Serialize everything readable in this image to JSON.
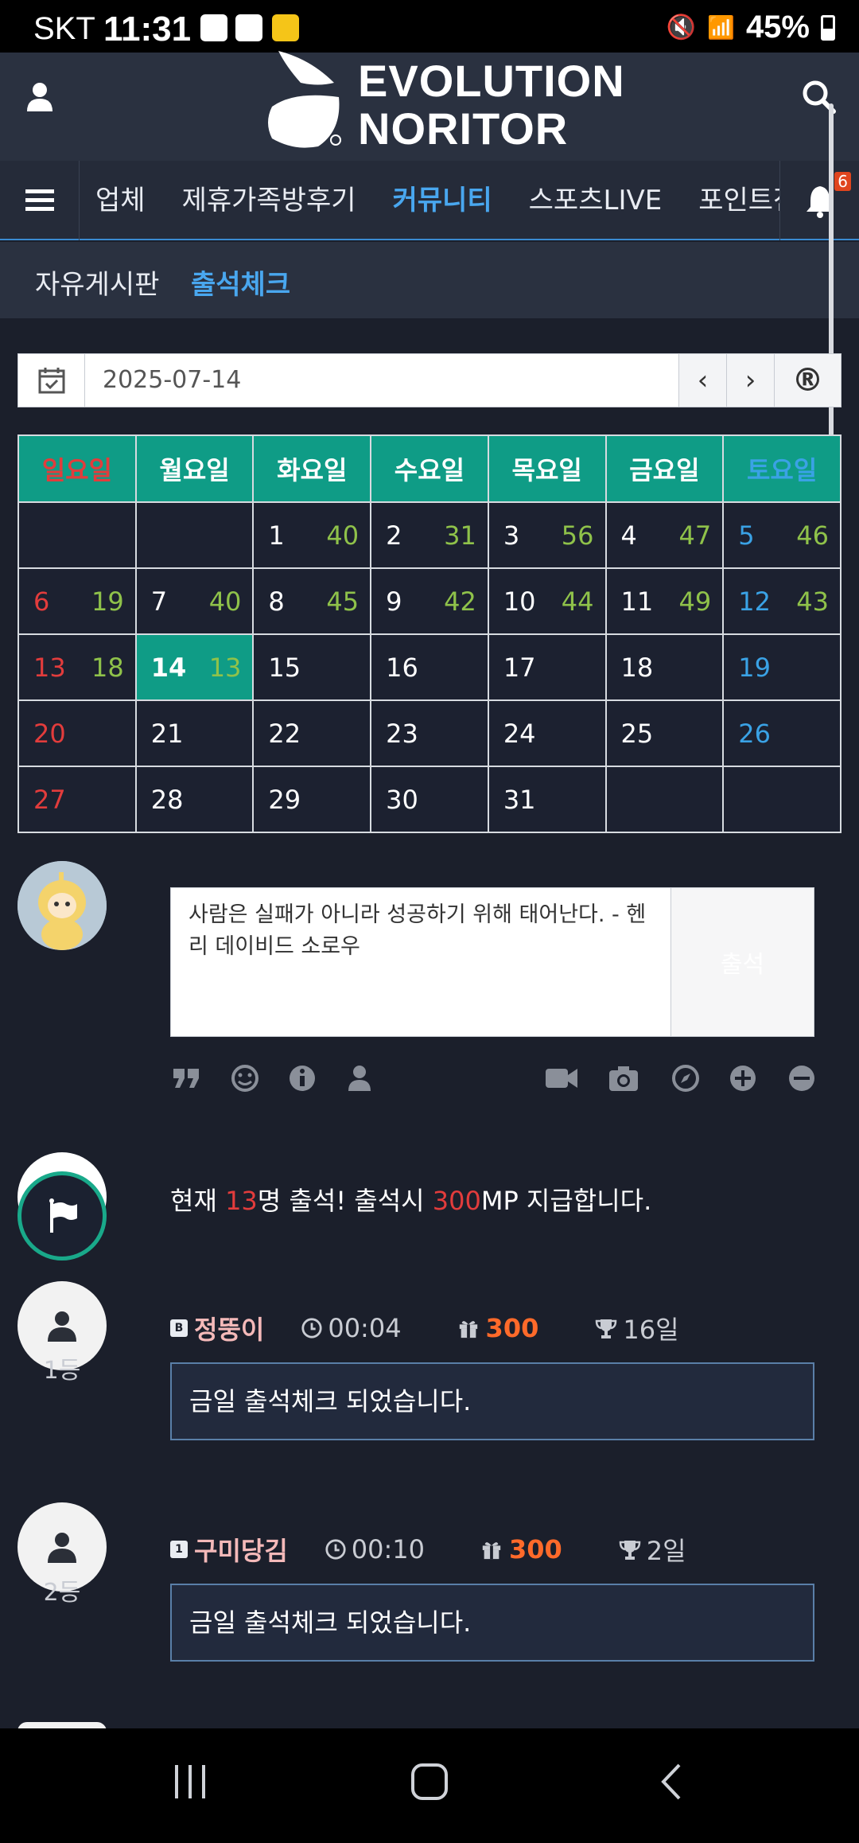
{
  "status_bar": {
    "carrier": "SKT",
    "time": "11:31",
    "battery": "45%"
  },
  "header": {
    "logo_line1": "EVOLUTION",
    "logo_line2": "NORITOR"
  },
  "nav": {
    "items": [
      "업체",
      "제휴가족방후기",
      "커뮤니티",
      "스포츠LIVE",
      "포인트전"
    ],
    "active": "커뮤니티",
    "bell_count": "6"
  },
  "subnav": {
    "items": [
      "자유게시판",
      "출석체크"
    ],
    "active": "출석체크"
  },
  "date_bar": {
    "value": "2025-07-14",
    "prev": "‹",
    "next": "›",
    "reset": "®"
  },
  "calendar": {
    "headers": [
      "일요일",
      "월요일",
      "화요일",
      "수요일",
      "목요일",
      "금요일",
      "토요일"
    ],
    "weeks": [
      [
        {
          "d": "",
          "c": ""
        },
        {
          "d": "",
          "c": ""
        },
        {
          "d": "1",
          "c": "40"
        },
        {
          "d": "2",
          "c": "31"
        },
        {
          "d": "3",
          "c": "56"
        },
        {
          "d": "4",
          "c": "47"
        },
        {
          "d": "5",
          "c": "46"
        }
      ],
      [
        {
          "d": "6",
          "c": "19"
        },
        {
          "d": "7",
          "c": "40"
        },
        {
          "d": "8",
          "c": "45"
        },
        {
          "d": "9",
          "c": "42"
        },
        {
          "d": "10",
          "c": "44"
        },
        {
          "d": "11",
          "c": "49"
        },
        {
          "d": "12",
          "c": "43"
        }
      ],
      [
        {
          "d": "13",
          "c": "18"
        },
        {
          "d": "14",
          "c": "13",
          "today": true
        },
        {
          "d": "15",
          "c": ""
        },
        {
          "d": "16",
          "c": ""
        },
        {
          "d": "17",
          "c": ""
        },
        {
          "d": "18",
          "c": ""
        },
        {
          "d": "19",
          "c": ""
        }
      ],
      [
        {
          "d": "20",
          "c": ""
        },
        {
          "d": "21",
          "c": ""
        },
        {
          "d": "22",
          "c": ""
        },
        {
          "d": "23",
          "c": ""
        },
        {
          "d": "24",
          "c": ""
        },
        {
          "d": "25",
          "c": ""
        },
        {
          "d": "26",
          "c": ""
        }
      ],
      [
        {
          "d": "27",
          "c": ""
        },
        {
          "d": "28",
          "c": ""
        },
        {
          "d": "29",
          "c": ""
        },
        {
          "d": "30",
          "c": ""
        },
        {
          "d": "31",
          "c": ""
        },
        {
          "d": "",
          "c": ""
        },
        {
          "d": "",
          "c": ""
        }
      ]
    ]
  },
  "comment": {
    "text": "사람은 실패가 아니라 성공하기 위해 태어난다. - 헨리 데이비드 소로우",
    "submit_label": "출석"
  },
  "summary": {
    "prefix": "현재 ",
    "count": "13",
    "middle": "명 출석! 출석시 ",
    "points": "300",
    "suffix": "MP 지급합니다."
  },
  "entries": [
    {
      "rank": "1등",
      "level": "B",
      "name": "정뚱이",
      "time": "00:04",
      "points": "300",
      "days": "16일",
      "message": "금일 출석체크 되었습니다."
    },
    {
      "rank": "2등",
      "level": "1",
      "name": "구미당김",
      "time": "00:10",
      "points": "300",
      "days": "2일",
      "message": "금일 출석체크 되었습니다."
    }
  ]
}
